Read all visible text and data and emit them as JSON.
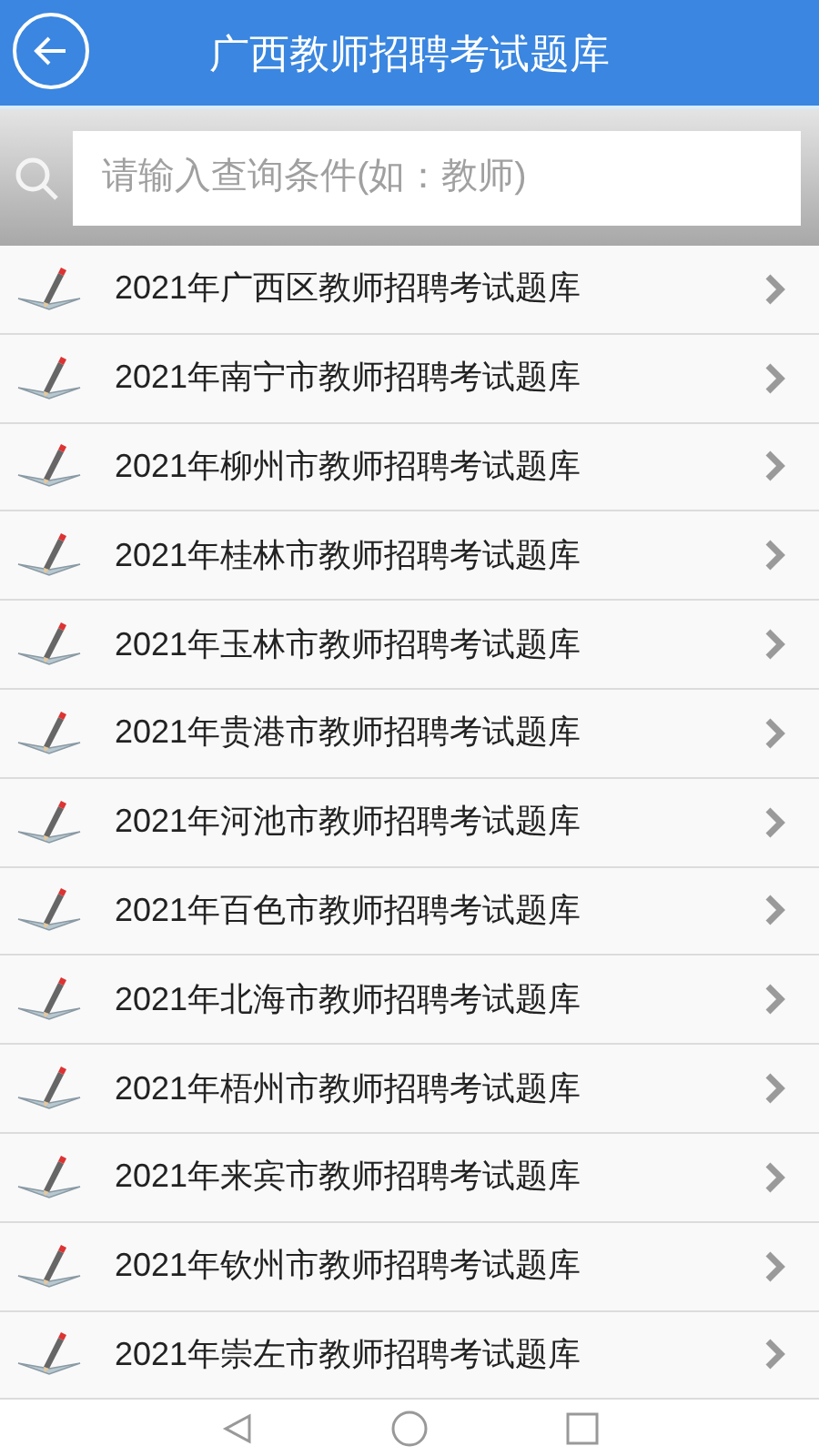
{
  "header": {
    "title": "广西教师招聘考试题库"
  },
  "search": {
    "placeholder": "请输入查询条件(如：教师)"
  },
  "items": [
    {
      "label": "2021年广西区教师招聘考试题库"
    },
    {
      "label": "2021年南宁市教师招聘考试题库"
    },
    {
      "label": "2021年柳州市教师招聘考试题库"
    },
    {
      "label": "2021年桂林市教师招聘考试题库"
    },
    {
      "label": "2021年玉林市教师招聘考试题库"
    },
    {
      "label": "2021年贵港市教师招聘考试题库"
    },
    {
      "label": "2021年河池市教师招聘考试题库"
    },
    {
      "label": "2021年百色市教师招聘考试题库"
    },
    {
      "label": "2021年北海市教师招聘考试题库"
    },
    {
      "label": "2021年梧州市教师招聘考试题库"
    },
    {
      "label": "2021年来宾市教师招聘考试题库"
    },
    {
      "label": "2021年钦州市教师招聘考试题库"
    },
    {
      "label": "2021年崇左市教师招聘考试题库"
    }
  ]
}
